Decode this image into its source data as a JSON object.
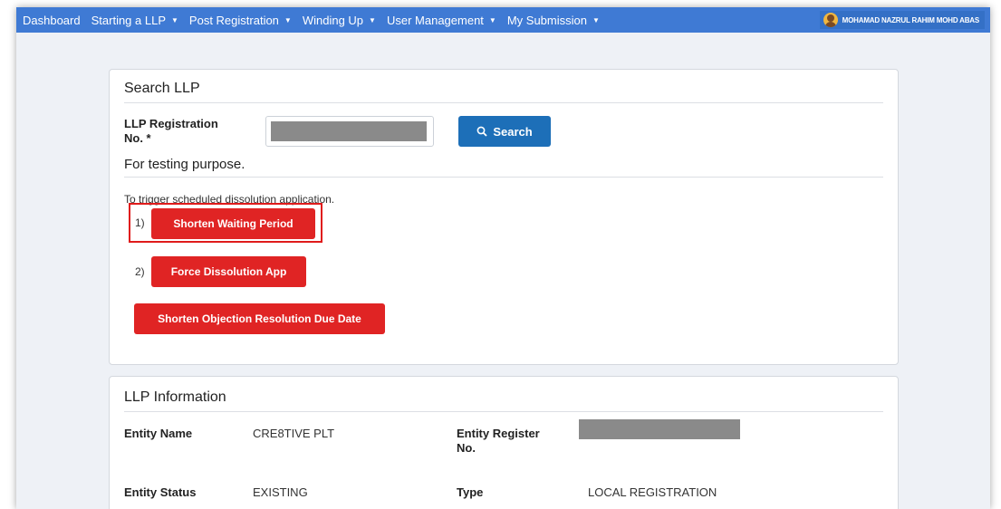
{
  "nav": {
    "items": [
      {
        "label": "Dashboard",
        "has_caret": false
      },
      {
        "label": "Starting a LLP",
        "has_caret": true
      },
      {
        "label": "Post Registration",
        "has_caret": true
      },
      {
        "label": "Winding Up",
        "has_caret": true
      },
      {
        "label": "User Management",
        "has_caret": true
      },
      {
        "label": "My Submission",
        "has_caret": true
      }
    ],
    "user_name": "MOHAMAD NAZRUL RAHIM MOHD ABAS",
    "color": "#3f7ad4"
  },
  "search_panel": {
    "title": "Search LLP",
    "reg_label_line1": "LLP Registration",
    "reg_label_line2": "No. *",
    "search_button": "Search",
    "testing_heading": "For testing purpose.",
    "note": "To trigger scheduled dissolution application.",
    "step1_num": "1)",
    "step2_num": "2)",
    "shorten_waiting_button": "Shorten Waiting Period",
    "force_dissolution_button": "Force Dissolution App",
    "shorten_objection_button": "Shorten Objection Resolution Due Date",
    "accent_red": "#e02424",
    "accent_blue": "#1d6fb8"
  },
  "info_panel": {
    "title": "LLP Information",
    "entity_name_label": "Entity Name",
    "entity_name_value": "CRE8TIVE PLT",
    "entity_reg_label_line1": "Entity Register",
    "entity_reg_label_line2": "No.",
    "entity_status_label": "Entity Status",
    "entity_status_value": "EXISTING",
    "type_label": "Type",
    "type_value": "LOCAL REGISTRATION"
  }
}
